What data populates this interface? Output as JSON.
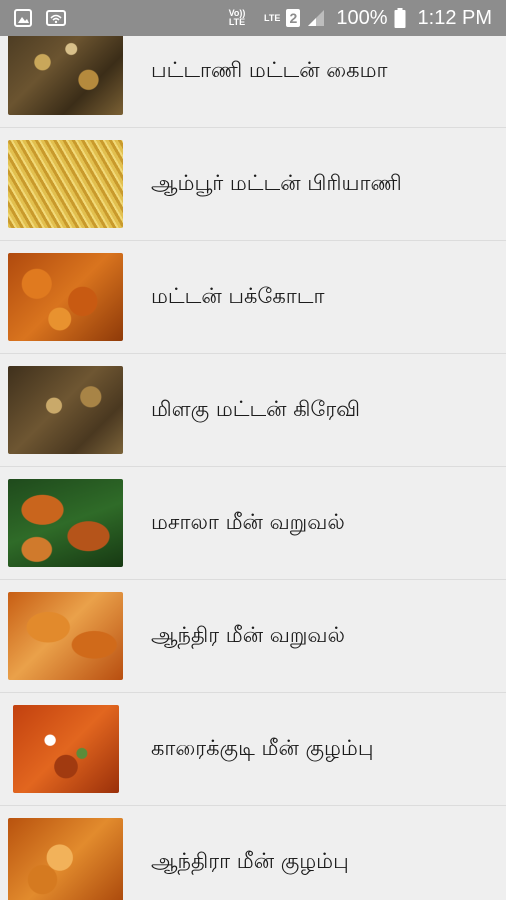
{
  "status_bar": {
    "left_icons": [
      "image-icon",
      "wifi-icon"
    ],
    "volte_label": "Vo)) LTE",
    "lte_label": "LTE",
    "sim_number": "2",
    "battery_percent": "100%",
    "time": "1:12 PM"
  },
  "recipes": [
    {
      "title": "பட்டாணி மட்டன் கைமா",
      "image": "mutton-keema-photo"
    },
    {
      "title": "ஆம்பூர் மட்டன் பிரியாணி",
      "image": "mutton-biryani-photo"
    },
    {
      "title": "மட்டன் பக்கோடா",
      "image": "mutton-pakoda-photo"
    },
    {
      "title": "மிளகு மட்டன் கிரேவி",
      "image": "pepper-mutton-gravy-photo"
    },
    {
      "title": "மசாலா மீன் வறுவல்",
      "image": "masala-fish-fry-photo"
    },
    {
      "title": "ஆந்திர மீன் வறுவல்",
      "image": "andhra-fish-fry-photo"
    },
    {
      "title": "காரைக்குடி மீன் குழம்பு",
      "image": "karaikudi-fish-curry-photo"
    },
    {
      "title": "ஆந்திரா மீன் குழம்பு",
      "image": "andhra-fish-curry-photo"
    }
  ]
}
